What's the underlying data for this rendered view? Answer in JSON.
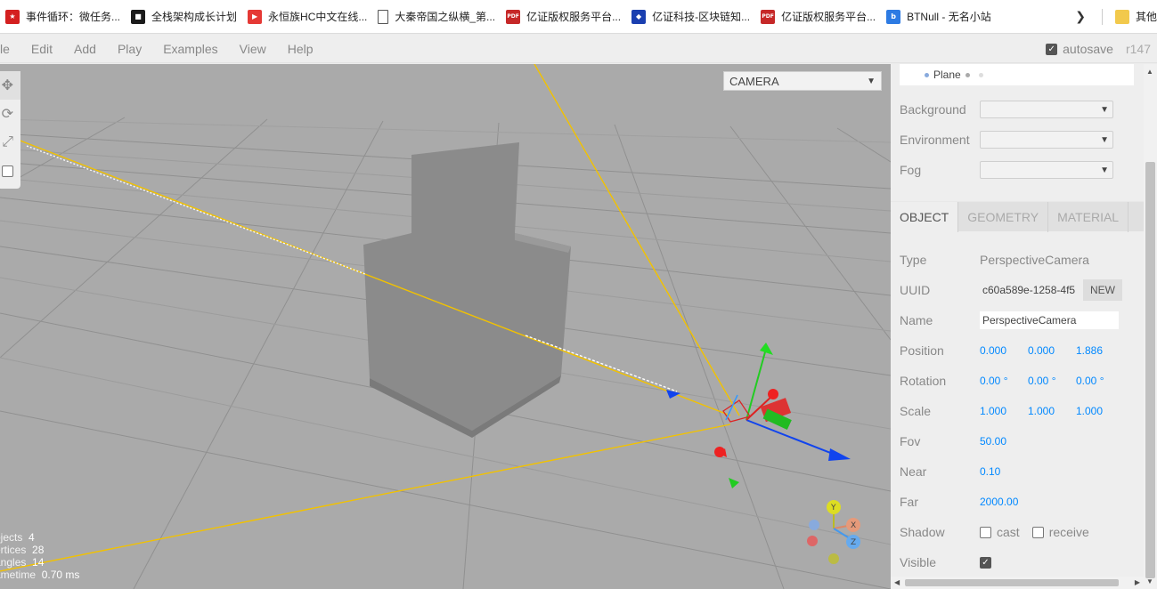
{
  "bookmarks": [
    {
      "label": "事件循环：微任务...",
      "icon": "red-flag-icon",
      "color": "#d42020",
      "glyph": "★"
    },
    {
      "label": "全栈架构成长计划",
      "icon": "dark-square-icon",
      "color": "#1b1b1b",
      "glyph": "■"
    },
    {
      "label": "永恒族HC中文在线...",
      "icon": "play-icon",
      "color": "#e53935",
      "glyph": "▶"
    },
    {
      "label": "大秦帝国之纵横_第...",
      "icon": "document-icon",
      "color": "#ffffff",
      "glyph": ""
    },
    {
      "label": "亿证版权服务平台...",
      "icon": "pdf-icon",
      "color": "#c62828",
      "glyph": "PDF"
    },
    {
      "label": "亿证科技-区块链知...",
      "icon": "diamond-logo-icon",
      "color": "#1a3fb0",
      "glyph": "◆"
    },
    {
      "label": "亿证版权服务平台...",
      "icon": "pdf-icon",
      "color": "#c62828",
      "glyph": "PDF"
    },
    {
      "label": "BTNull - 无名小站",
      "icon": "btnull-icon",
      "color": "#2d7be3",
      "glyph": "b"
    }
  ],
  "bookmarks_more": "其他",
  "menubar": {
    "items": [
      "le",
      "Edit",
      "Add",
      "Play",
      "Examples",
      "View",
      "Help"
    ],
    "autosave_label": "autosave",
    "autosave_checked": true,
    "version": "r147"
  },
  "viewport": {
    "camera_select": "CAMERA",
    "info": [
      {
        "label": "ojects",
        "value": "4"
      },
      {
        "label": "ertices",
        "value": "28"
      },
      {
        "label": "angles",
        "value": "14"
      },
      {
        "label": "ametime",
        "value": "0.70 ms"
      }
    ]
  },
  "outliner": {
    "item": "Plane"
  },
  "scene_props": {
    "background": "Background",
    "environment": "Environment",
    "fog": "Fog"
  },
  "tabs": [
    {
      "label": "OBJECT",
      "active": true
    },
    {
      "label": "GEOMETRY",
      "active": false
    },
    {
      "label": "MATERIAL",
      "active": false
    }
  ],
  "object": {
    "type_label": "Type",
    "type_value": "PerspectiveCamera",
    "uuid_label": "UUID",
    "uuid_value": "c60a589e-1258-4f5",
    "new_button": "NEW",
    "name_label": "Name",
    "name_value": "PerspectiveCamera",
    "position_label": "Position",
    "position": [
      "0.000",
      "0.000",
      "1.886"
    ],
    "rotation_label": "Rotation",
    "rotation": [
      "0.00 °",
      "0.00 °",
      "0.00 °"
    ],
    "scale_label": "Scale",
    "scale": [
      "1.000",
      "1.000",
      "1.000"
    ],
    "fov_label": "Fov",
    "fov_value": "50.00",
    "near_label": "Near",
    "near_value": "0.10",
    "far_label": "Far",
    "far_value": "2000.00",
    "shadow_label": "Shadow",
    "cast_label": "cast",
    "receive_label": "receive",
    "visible_label": "Visible",
    "visible_checked": true
  },
  "colors": {
    "accent_number": "#0088ff",
    "viewport_bg": "#aaaaaa",
    "frustum_line": "#ffcc00"
  }
}
